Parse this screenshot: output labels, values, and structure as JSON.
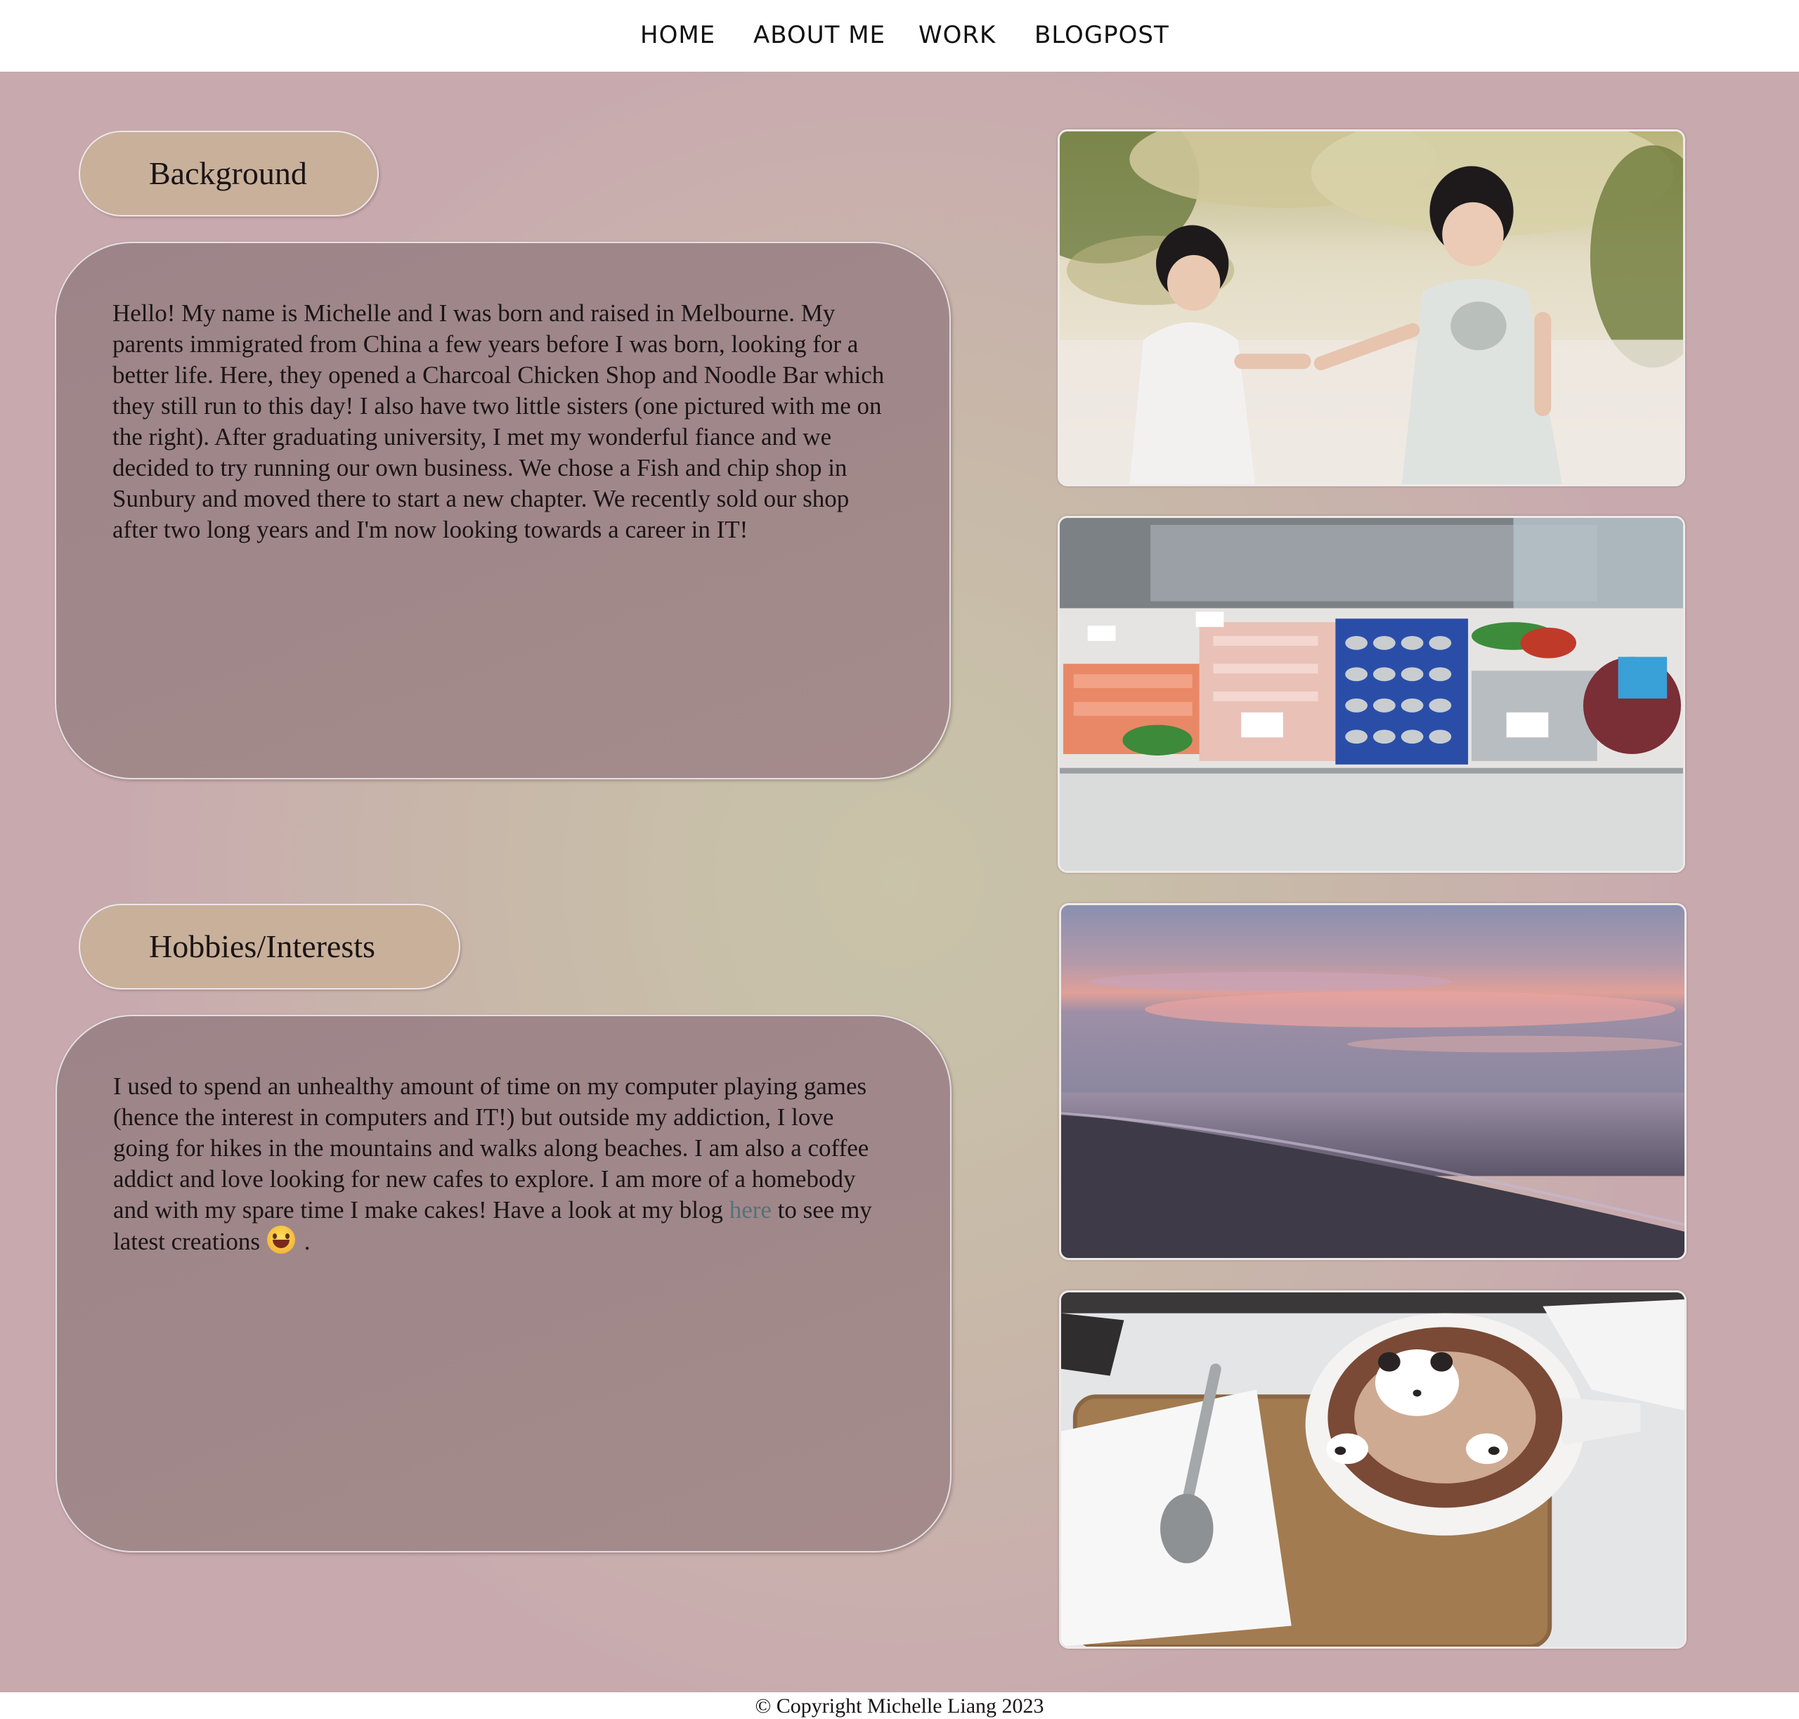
{
  "nav": {
    "items": [
      {
        "label": "HOME"
      },
      {
        "label": "ABOUT ME"
      },
      {
        "label": "WORK"
      },
      {
        "label": "BLOGPOST"
      }
    ]
  },
  "background": {
    "heading": "Background",
    "text": "Hello! My name is Michelle and I was born and raised in Melbourne. My parents immigrated from China a few years before I was born, looking for a better life. Here, they opened a Charcoal Chicken Shop and Noodle Bar which they still run to this day! I also have two little sisters (one pictured with me on the right). After graduating university, I met my wonderful fiance and we decided to try running our own business. We chose a Fish and chip shop in Sunbury and moved there to start a new chapter. We recently sold our shop after two long years and I'm now looking towards a career in IT!"
  },
  "hobbies": {
    "heading": "Hobbies/Interests",
    "text_before_link": "I used to spend an unhealthy amount of time on my computer playing games (hence the interest in computers and IT!) but outside my addiction, I love going for hikes in the mountains and walks along beaches. I am also a coffee addict and love looking for new cafes to explore. I am more of a homebody and with my spare time I make cakes! Have a look at my blog ",
    "link_text": "here",
    "text_after_link": " to see my latest creations",
    "text_end": " ."
  },
  "photos": [
    {
      "name": "sisters-photo"
    },
    {
      "name": "fish-shop-display-photo"
    },
    {
      "name": "beach-sunset-photo"
    },
    {
      "name": "bear-latte-photo"
    }
  ],
  "footer": {
    "copyright": "© Copyright Michelle Liang 2023"
  },
  "colors": {
    "pill": "#c8b09a",
    "card": "#a0888a",
    "link": "#58707a"
  }
}
